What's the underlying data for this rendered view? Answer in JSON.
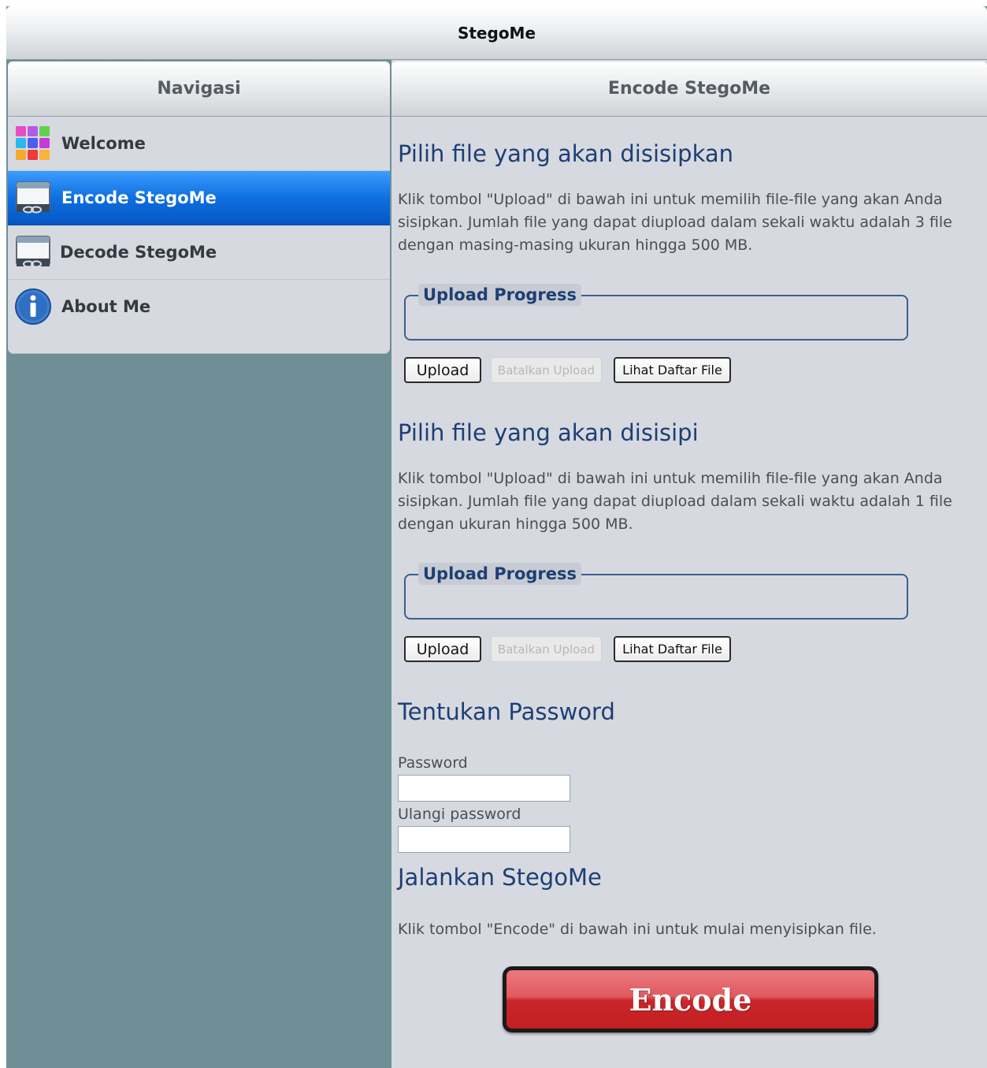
{
  "app": {
    "title": "StegoMe"
  },
  "sidebar": {
    "header": "Navigasi",
    "items": [
      {
        "label": "Welcome",
        "icon": "welcome-grid-icon",
        "active": false
      },
      {
        "label": "Encode StegoMe",
        "icon": "encode-window-link-icon",
        "active": true
      },
      {
        "label": "Decode StegoMe",
        "icon": "decode-window-link-icon",
        "active": false
      },
      {
        "label": "About Me",
        "icon": "info-icon",
        "active": false
      }
    ]
  },
  "main": {
    "header": "Encode StegoMe",
    "section1": {
      "title": "Pilih file yang akan disisipkan",
      "desc": "Klik tombol \"Upload\" di bawah ini untuk memilih file-file yang akan Anda sisipkan. Jumlah file yang dapat diupload dalam sekali waktu adalah 3 file dengan masing-masing ukuran hingga 500 MB.",
      "progress_legend": "Upload Progress",
      "upload_label": "Upload",
      "cancel_label": "Batalkan Upload",
      "list_label": "Lihat Daftar File"
    },
    "section2": {
      "title": "Pilih file yang akan disisipi",
      "desc": "Klik tombol \"Upload\" di bawah ini untuk memilih file-file yang akan Anda sisipkan. Jumlah file yang dapat diupload dalam sekali waktu adalah 1 file dengan ukuran hingga 500 MB.",
      "progress_legend": "Upload Progress",
      "upload_label": "Upload",
      "cancel_label": "Batalkan Upload",
      "list_label": "Lihat Daftar File"
    },
    "password": {
      "title": "Tentukan Password",
      "password_label": "Password",
      "password_value": "",
      "repeat_label": "Ulangi password",
      "repeat_value": ""
    },
    "run": {
      "title": "Jalankan StegoMe",
      "desc": "Klik tombol \"Encode\" di bawah ini untuk mulai menyisipkan file.",
      "encode_label": "Encode"
    }
  },
  "colors": {
    "background": "#6e8f96",
    "panel": "#d6d9e0",
    "heading": "#1d3f74",
    "active_nav": "#0f6fe0",
    "encode_button": "#c8262a"
  }
}
